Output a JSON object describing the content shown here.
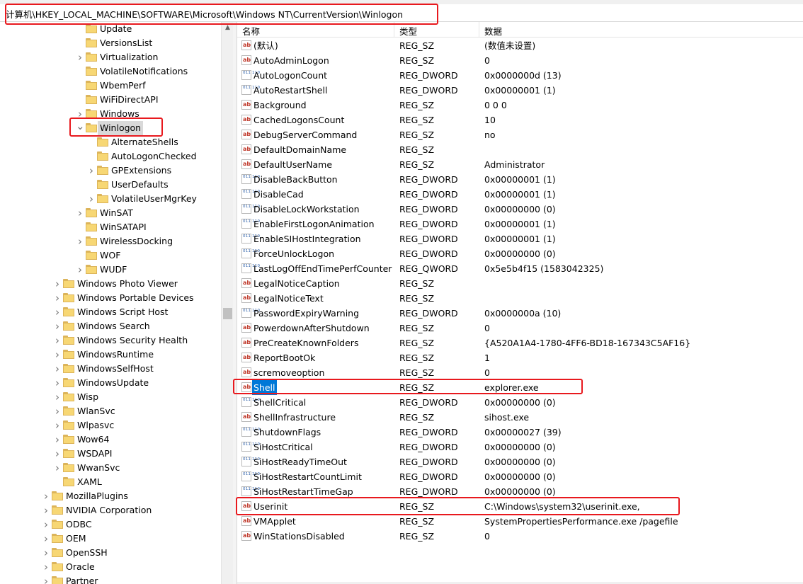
{
  "address_bar": {
    "path": "计算机\\HKEY_LOCAL_MACHINE\\SOFTWARE\\Microsoft\\Windows NT\\CurrentVersion\\Winlogon"
  },
  "tree": {
    "items": [
      {
        "label": "Update",
        "level": 3,
        "expandable": false,
        "expanded": false,
        "selected": false
      },
      {
        "label": "VersionsList",
        "level": 3,
        "expandable": false,
        "expanded": false,
        "selected": false
      },
      {
        "label": "Virtualization",
        "level": 3,
        "expandable": true,
        "expanded": false,
        "selected": false
      },
      {
        "label": "VolatileNotifications",
        "level": 3,
        "expandable": false,
        "expanded": false,
        "selected": false
      },
      {
        "label": "WbemPerf",
        "level": 3,
        "expandable": false,
        "expanded": false,
        "selected": false
      },
      {
        "label": "WiFiDirectAPI",
        "level": 3,
        "expandable": false,
        "expanded": false,
        "selected": false
      },
      {
        "label": "Windows",
        "level": 3,
        "expandable": true,
        "expanded": false,
        "selected": false
      },
      {
        "label": "Winlogon",
        "level": 3,
        "expandable": true,
        "expanded": true,
        "selected": true
      },
      {
        "label": "AlternateShells",
        "level": 4,
        "expandable": false,
        "expanded": false,
        "selected": false
      },
      {
        "label": "AutoLogonChecked",
        "level": 4,
        "expandable": false,
        "expanded": false,
        "selected": false
      },
      {
        "label": "GPExtensions",
        "level": 4,
        "expandable": true,
        "expanded": false,
        "selected": false
      },
      {
        "label": "UserDefaults",
        "level": 4,
        "expandable": false,
        "expanded": false,
        "selected": false
      },
      {
        "label": "VolatileUserMgrKey",
        "level": 4,
        "expandable": true,
        "expanded": false,
        "selected": false
      },
      {
        "label": "WinSAT",
        "level": 3,
        "expandable": true,
        "expanded": false,
        "selected": false
      },
      {
        "label": "WinSATAPI",
        "level": 3,
        "expandable": false,
        "expanded": false,
        "selected": false
      },
      {
        "label": "WirelessDocking",
        "level": 3,
        "expandable": true,
        "expanded": false,
        "selected": false
      },
      {
        "label": "WOF",
        "level": 3,
        "expandable": false,
        "expanded": false,
        "selected": false
      },
      {
        "label": "WUDF",
        "level": 3,
        "expandable": true,
        "expanded": false,
        "selected": false
      },
      {
        "label": "Windows Photo Viewer",
        "level": 2,
        "expandable": true,
        "expanded": false,
        "selected": false
      },
      {
        "label": "Windows Portable Devices",
        "level": 2,
        "expandable": true,
        "expanded": false,
        "selected": false
      },
      {
        "label": "Windows Script Host",
        "level": 2,
        "expandable": true,
        "expanded": false,
        "selected": false
      },
      {
        "label": "Windows Search",
        "level": 2,
        "expandable": true,
        "expanded": false,
        "selected": false
      },
      {
        "label": "Windows Security Health",
        "level": 2,
        "expandable": true,
        "expanded": false,
        "selected": false
      },
      {
        "label": "WindowsRuntime",
        "level": 2,
        "expandable": true,
        "expanded": false,
        "selected": false
      },
      {
        "label": "WindowsSelfHost",
        "level": 2,
        "expandable": true,
        "expanded": false,
        "selected": false
      },
      {
        "label": "WindowsUpdate",
        "level": 2,
        "expandable": true,
        "expanded": false,
        "selected": false
      },
      {
        "label": "Wisp",
        "level": 2,
        "expandable": true,
        "expanded": false,
        "selected": false
      },
      {
        "label": "WlanSvc",
        "level": 2,
        "expandable": true,
        "expanded": false,
        "selected": false
      },
      {
        "label": "Wlpasvc",
        "level": 2,
        "expandable": true,
        "expanded": false,
        "selected": false
      },
      {
        "label": "Wow64",
        "level": 2,
        "expandable": true,
        "expanded": false,
        "selected": false
      },
      {
        "label": "WSDAPI",
        "level": 2,
        "expandable": true,
        "expanded": false,
        "selected": false
      },
      {
        "label": "WwanSvc",
        "level": 2,
        "expandable": true,
        "expanded": false,
        "selected": false
      },
      {
        "label": "XAML",
        "level": 2,
        "expandable": false,
        "expanded": false,
        "selected": false
      },
      {
        "label": "MozillaPlugins",
        "level": 1,
        "expandable": true,
        "expanded": false,
        "selected": false
      },
      {
        "label": "NVIDIA Corporation",
        "level": 1,
        "expandable": true,
        "expanded": false,
        "selected": false
      },
      {
        "label": "ODBC",
        "level": 1,
        "expandable": true,
        "expanded": false,
        "selected": false
      },
      {
        "label": "OEM",
        "level": 1,
        "expandable": true,
        "expanded": false,
        "selected": false
      },
      {
        "label": "OpenSSH",
        "level": 1,
        "expandable": true,
        "expanded": false,
        "selected": false
      },
      {
        "label": "Oracle",
        "level": 1,
        "expandable": true,
        "expanded": false,
        "selected": false
      },
      {
        "label": "Partner",
        "level": 1,
        "expandable": true,
        "expanded": false,
        "selected": false
      }
    ]
  },
  "list": {
    "headers": {
      "name": "名称",
      "type": "类型",
      "data": "数据"
    },
    "rows": [
      {
        "name": "(默认)",
        "type": "REG_SZ",
        "data": "(数值未设置)",
        "icon": "string-value-icon",
        "selected": false
      },
      {
        "name": "AutoAdminLogon",
        "type": "REG_SZ",
        "data": "0",
        "icon": "string-value-icon",
        "selected": false
      },
      {
        "name": "AutoLogonCount",
        "type": "REG_DWORD",
        "data": "0x0000000d (13)",
        "icon": "binary-value-icon",
        "selected": false
      },
      {
        "name": "AutoRestartShell",
        "type": "REG_DWORD",
        "data": "0x00000001 (1)",
        "icon": "binary-value-icon",
        "selected": false
      },
      {
        "name": "Background",
        "type": "REG_SZ",
        "data": "0 0 0",
        "icon": "string-value-icon",
        "selected": false
      },
      {
        "name": "CachedLogonsCount",
        "type": "REG_SZ",
        "data": "10",
        "icon": "string-value-icon",
        "selected": false
      },
      {
        "name": "DebugServerCommand",
        "type": "REG_SZ",
        "data": "no",
        "icon": "string-value-icon",
        "selected": false
      },
      {
        "name": "DefaultDomainName",
        "type": "REG_SZ",
        "data": "",
        "icon": "string-value-icon",
        "selected": false
      },
      {
        "name": "DefaultUserName",
        "type": "REG_SZ",
        "data": "Administrator",
        "icon": "string-value-icon",
        "selected": false
      },
      {
        "name": "DisableBackButton",
        "type": "REG_DWORD",
        "data": "0x00000001 (1)",
        "icon": "binary-value-icon",
        "selected": false
      },
      {
        "name": "DisableCad",
        "type": "REG_DWORD",
        "data": "0x00000001 (1)",
        "icon": "binary-value-icon",
        "selected": false
      },
      {
        "name": "DisableLockWorkstation",
        "type": "REG_DWORD",
        "data": "0x00000000 (0)",
        "icon": "binary-value-icon",
        "selected": false
      },
      {
        "name": "EnableFirstLogonAnimation",
        "type": "REG_DWORD",
        "data": "0x00000001 (1)",
        "icon": "binary-value-icon",
        "selected": false
      },
      {
        "name": "EnableSIHostIntegration",
        "type": "REG_DWORD",
        "data": "0x00000001 (1)",
        "icon": "binary-value-icon",
        "selected": false
      },
      {
        "name": "ForceUnlockLogon",
        "type": "REG_DWORD",
        "data": "0x00000000 (0)",
        "icon": "binary-value-icon",
        "selected": false
      },
      {
        "name": "LastLogOffEndTimePerfCounter",
        "type": "REG_QWORD",
        "data": "0x5e5b4f15 (1583042325)",
        "icon": "binary-value-icon",
        "selected": false
      },
      {
        "name": "LegalNoticeCaption",
        "type": "REG_SZ",
        "data": "",
        "icon": "string-value-icon",
        "selected": false
      },
      {
        "name": "LegalNoticeText",
        "type": "REG_SZ",
        "data": "",
        "icon": "string-value-icon",
        "selected": false
      },
      {
        "name": "PasswordExpiryWarning",
        "type": "REG_DWORD",
        "data": "0x0000000a (10)",
        "icon": "binary-value-icon",
        "selected": false
      },
      {
        "name": "PowerdownAfterShutdown",
        "type": "REG_SZ",
        "data": "0",
        "icon": "string-value-icon",
        "selected": false
      },
      {
        "name": "PreCreateKnownFolders",
        "type": "REG_SZ",
        "data": "{A520A1A4-1780-4FF6-BD18-167343C5AF16}",
        "icon": "string-value-icon",
        "selected": false
      },
      {
        "name": "ReportBootOk",
        "type": "REG_SZ",
        "data": "1",
        "icon": "string-value-icon",
        "selected": false
      },
      {
        "name": "scremoveoption",
        "type": "REG_SZ",
        "data": "0",
        "icon": "string-value-icon",
        "selected": false
      },
      {
        "name": "Shell",
        "type": "REG_SZ",
        "data": "explorer.exe",
        "icon": "string-value-icon",
        "selected": true
      },
      {
        "name": "ShellCritical",
        "type": "REG_DWORD",
        "data": "0x00000000 (0)",
        "icon": "binary-value-icon",
        "selected": false
      },
      {
        "name": "ShellInfrastructure",
        "type": "REG_SZ",
        "data": "sihost.exe",
        "icon": "string-value-icon",
        "selected": false
      },
      {
        "name": "ShutdownFlags",
        "type": "REG_DWORD",
        "data": "0x00000027 (39)",
        "icon": "binary-value-icon",
        "selected": false
      },
      {
        "name": "SiHostCritical",
        "type": "REG_DWORD",
        "data": "0x00000000 (0)",
        "icon": "binary-value-icon",
        "selected": false
      },
      {
        "name": "SiHostReadyTimeOut",
        "type": "REG_DWORD",
        "data": "0x00000000 (0)",
        "icon": "binary-value-icon",
        "selected": false
      },
      {
        "name": "SiHostRestartCountLimit",
        "type": "REG_DWORD",
        "data": "0x00000000 (0)",
        "icon": "binary-value-icon",
        "selected": false
      },
      {
        "name": "SiHostRestartTimeGap",
        "type": "REG_DWORD",
        "data": "0x00000000 (0)",
        "icon": "binary-value-icon",
        "selected": false
      },
      {
        "name": "Userinit",
        "type": "REG_SZ",
        "data": "C:\\Windows\\system32\\userinit.exe,",
        "icon": "string-value-icon",
        "selected": false
      },
      {
        "name": "VMApplet",
        "type": "REG_SZ",
        "data": "SystemPropertiesPerformance.exe /pagefile",
        "icon": "string-value-icon",
        "selected": false
      },
      {
        "name": "WinStationsDisabled",
        "type": "REG_SZ",
        "data": "0",
        "icon": "string-value-icon",
        "selected": false
      }
    ]
  },
  "colors": {
    "annotation": "#e8191e",
    "selection": "#0078d7",
    "folder": "#f7d774"
  }
}
